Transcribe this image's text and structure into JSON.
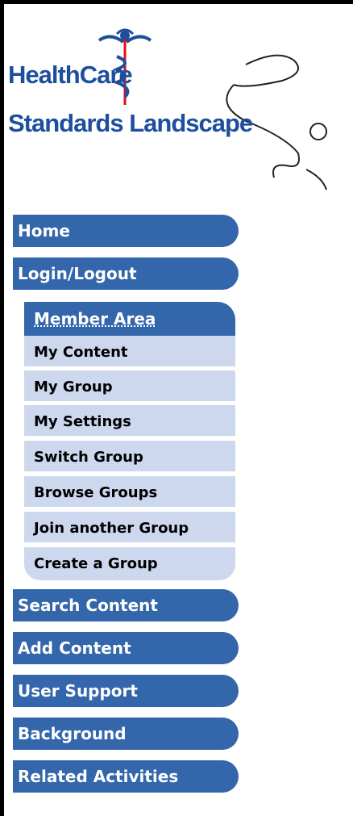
{
  "logo": {
    "line1": "HealthCare",
    "line2": "Standards Landscape"
  },
  "nav": {
    "home": "Home",
    "login": "Login/Logout",
    "member_area": "Member Area",
    "member_items": [
      "My Content",
      "My Group",
      "My Settings",
      "Switch Group",
      "Browse Groups",
      "Join another Group",
      "Create a Group"
    ],
    "search": "Search Content",
    "add": "Add Content",
    "support": "User Support",
    "background": "Background",
    "related": "Related Activities"
  },
  "colors": {
    "nav_bg": "#3366aa",
    "sub_bg": "#cdd8ee",
    "logo_text": "#1d4f9c"
  }
}
